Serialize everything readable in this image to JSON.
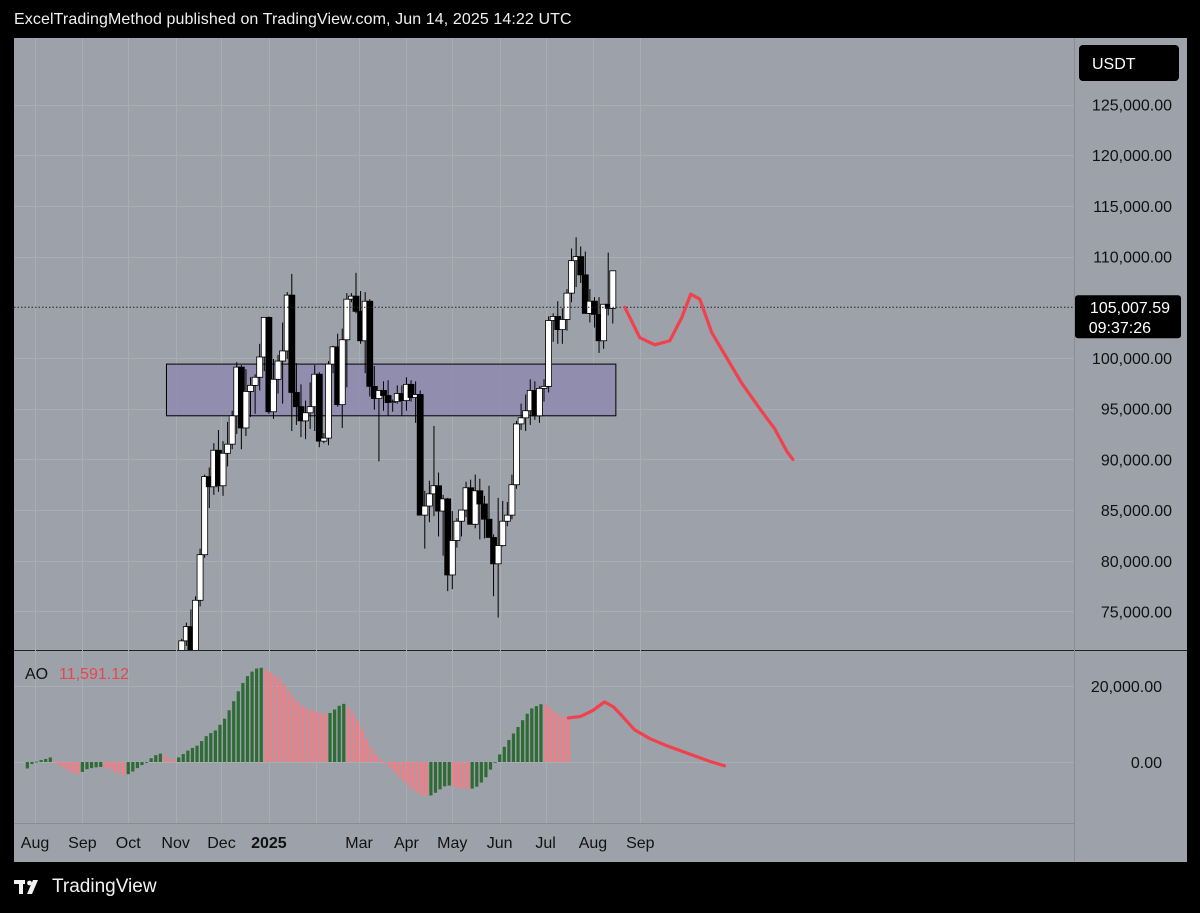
{
  "header": {
    "published": "ExcelTradingMethod published on TradingView.com, Jun 14, 2025 14:22 UTC"
  },
  "footer": {
    "brand": "TradingView"
  },
  "colors": {
    "panel_bg": "#9da1a9",
    "bull": "#ffffff",
    "bear": "#000000",
    "zone_fill": "#8e8aaf",
    "projection": "#f0414d",
    "ao_green": "#2e6b35",
    "ao_red": "#ef7f86",
    "last_price_bg": "#000000"
  },
  "chart_data": [
    {
      "type": "candlestick",
      "symbol_unit": "USDT",
      "title": "",
      "x_axis": {
        "ticks": [
          "Aug",
          "Sep",
          "Oct",
          "Nov",
          "Dec",
          "2025",
          "Mar",
          "Apr",
          "May",
          "Jun",
          "Jul",
          "Aug",
          "Sep"
        ]
      },
      "y_axis": {
        "ticks": [
          "125,000.00",
          "120,000.00",
          "115,000.00",
          "110,000.00",
          "100,000.00",
          "95,000.00",
          "90,000.00",
          "85,000.00",
          "80,000.00",
          "75,000.00"
        ],
        "ylim": [
          70000,
          128000
        ]
      },
      "last_price": {
        "value": "105,007.59",
        "countdown": "09:37:26",
        "numeric": 105008
      },
      "zone": {
        "low": 94300,
        "high": 99400,
        "from": "2024-10-26",
        "to": "2025-08-16"
      },
      "candles_start_date": "2024-11-05",
      "candles": [
        [
          69400,
          72300,
          67200,
          72100
        ],
        [
          72100,
          73900,
          71600,
          73500
        ],
        [
          73500,
          75200,
          69700,
          70600
        ],
        [
          70600,
          76500,
          70400,
          76100
        ],
        [
          76100,
          81200,
          75500,
          80600
        ],
        [
          80600,
          88500,
          80300,
          88300
        ],
        [
          88300,
          89200,
          85200,
          87300
        ],
        [
          87300,
          91600,
          86500,
          90900
        ],
        [
          90900,
          92900,
          86800,
          87400
        ],
        [
          87400,
          91800,
          86400,
          90600
        ],
        [
          90600,
          93700,
          89300,
          91500
        ],
        [
          91500,
          94800,
          91000,
          94300
        ],
        [
          94300,
          99600,
          92500,
          99100
        ],
        [
          99100,
          99300,
          91000,
          93100
        ],
        [
          93100,
          98900,
          92300,
          96700
        ],
        [
          96700,
          98100,
          94200,
          97300
        ],
        [
          97300,
          98400,
          94500,
          98100
        ],
        [
          98100,
          101400,
          96800,
          100100
        ],
        [
          100100,
          104000,
          98700,
          104000
        ],
        [
          104000,
          104100,
          94500,
          94700
        ],
        [
          94700,
          99900,
          94000,
          97900
        ],
        [
          97900,
          100300,
          96500,
          99700
        ],
        [
          99700,
          103500,
          95500,
          100700
        ],
        [
          100700,
          106500,
          99900,
          106200
        ],
        [
          106200,
          108300,
          92800,
          96600
        ],
        [
          96600,
          99500,
          93400,
          95200
        ],
        [
          95200,
          97400,
          92200,
          93800
        ],
        [
          93800,
          95800,
          92000,
          94600
        ],
        [
          94600,
          97600,
          93000,
          95200
        ],
        [
          95200,
          99300,
          92800,
          98400
        ],
        [
          98400,
          98600,
          91200,
          91800
        ],
        [
          91800,
          92600,
          91600,
          92100
        ],
        [
          92100,
          99700,
          91400,
          99400
        ],
        [
          99400,
          101200,
          98500,
          101100
        ],
        [
          101100,
          102400,
          95200,
          95400
        ],
        [
          95400,
          102900,
          93100,
          101800
        ],
        [
          101800,
          106400,
          97100,
          105800
        ],
        [
          105800,
          106400,
          105500,
          106100
        ],
        [
          106100,
          108400,
          104400,
          104600
        ],
        [
          104600,
          106600,
          101400,
          101700
        ],
        [
          101700,
          106500,
          98500,
          105600
        ],
        [
          105600,
          105800,
          96200,
          97200
        ],
        [
          97200,
          99200,
          94900,
          96000
        ],
        [
          96000,
          96600,
          89800,
          96800
        ],
        [
          96800,
          97700,
          94800,
          96300
        ],
        [
          96300,
          97800,
          94300,
          95600
        ],
        [
          95600,
          95900,
          94700,
          95700
        ],
        [
          95700,
          97300,
          95500,
          96500
        ],
        [
          96500,
          97300,
          94300,
          95800
        ],
        [
          95800,
          98100,
          94800,
          97400
        ],
        [
          97400,
          97800,
          95700,
          96100
        ],
        [
          96100,
          97700,
          93600,
          96400
        ],
        [
          96400,
          96800,
          84500,
          84500
        ],
        [
          84500,
          86900,
          81200,
          85400
        ],
        [
          85400,
          87900,
          83800,
          86600
        ],
        [
          86600,
          93300,
          84400,
          87400
        ],
        [
          87400,
          88700,
          82400,
          84900
        ],
        [
          84900,
          86500,
          80500,
          86100
        ],
        [
          86100,
          86200,
          77000,
          78600
        ],
        [
          78600,
          84900,
          77200,
          82000
        ],
        [
          82000,
          84200,
          81300,
          83900
        ],
        [
          83900,
          84700,
          82400,
          85000
        ],
        [
          85000,
          87800,
          84300,
          87200
        ],
        [
          87200,
          88000,
          83800,
          83600
        ],
        [
          83600,
          88500,
          83200,
          86900
        ],
        [
          86900,
          88100,
          82100,
          85600
        ],
        [
          85600,
          86400,
          82200,
          84100
        ],
        [
          84100,
          87400,
          82300,
          82300
        ],
        [
          82300,
          82600,
          76500,
          79700
        ],
        [
          79700,
          86200,
          74400,
          81500
        ],
        [
          81500,
          85900,
          81400,
          83900
        ],
        [
          83900,
          85800,
          83400,
          84500
        ],
        [
          84500,
          88500,
          84100,
          87500
        ],
        [
          87500,
          93800,
          87100,
          93500
        ],
        [
          93500,
          95500,
          92900,
          94100
        ],
        [
          94100,
          96400,
          92800,
          94800
        ],
        [
          94800,
          97900,
          93400,
          96800
        ],
        [
          96800,
          97700,
          93900,
          94300
        ],
        [
          94300,
          97200,
          93600,
          97000
        ],
        [
          97000,
          97900,
          95700,
          97200
        ],
        [
          97200,
          104100,
          96600,
          103700
        ],
        [
          103700,
          104400,
          101600,
          104100
        ],
        [
          104100,
          105600,
          101400,
          102800
        ],
        [
          102800,
          104900,
          101400,
          103800
        ],
        [
          103800,
          106800,
          102700,
          106400
        ],
        [
          106400,
          110800,
          105500,
          109600
        ],
        [
          109600,
          111900,
          107000,
          110000
        ],
        [
          110000,
          111000,
          107400,
          108200
        ],
        [
          108200,
          110500,
          106300,
          104400
        ],
        [
          104400,
          106800,
          103500,
          105600
        ],
        [
          105600,
          106000,
          103000,
          104300
        ],
        [
          104300,
          106000,
          100500,
          101700
        ],
        [
          101700,
          105200,
          100900,
          105300
        ],
        [
          105300,
          110400,
          104200,
          104900
        ],
        [
          104900,
          108600,
          103400,
          108600
        ]
      ],
      "projection": [
        [
          0,
          105000
        ],
        [
          5,
          102000
        ],
        [
          10,
          101300
        ],
        [
          15,
          101700
        ],
        [
          19,
          104000
        ],
        [
          22,
          106300
        ],
        [
          25,
          105800
        ],
        [
          29,
          102500
        ],
        [
          34,
          100000
        ],
        [
          39,
          97500
        ],
        [
          45,
          95000
        ],
        [
          50,
          93000
        ],
        [
          54,
          90800
        ],
        [
          56,
          90000
        ]
      ]
    },
    {
      "type": "bar",
      "name": "AO",
      "current_value_label": "11,591.12",
      "y_axis": {
        "ticks": [
          "20,000.00",
          "0.00"
        ],
        "ylim": [
          -9500,
          25500
        ]
      },
      "values": [
        -1700,
        -500,
        100,
        500,
        800,
        1200,
        500,
        -800,
        -1600,
        -2300,
        -2900,
        -3200,
        -2600,
        -1900,
        -1600,
        -1400,
        -1300,
        -1500,
        -1900,
        -2500,
        -3100,
        -3500,
        -3200,
        -2500,
        -1600,
        -800,
        0,
        1000,
        1800,
        2200,
        1700,
        800,
        700,
        1200,
        2100,
        3000,
        3700,
        4300,
        5500,
        6800,
        7600,
        8300,
        9800,
        11400,
        13600,
        16000,
        18600,
        20800,
        22600,
        23800,
        24600,
        24800,
        24200,
        23600,
        22800,
        21800,
        20300,
        18700,
        17000,
        15700,
        14700,
        14000,
        13600,
        13200,
        12800,
        12600,
        12900,
        13800,
        14800,
        15300,
        14400,
        12800,
        10800,
        8600,
        6100,
        3700,
        1900,
        700,
        -400,
        -1400,
        -2500,
        -3800,
        -5000,
        -6200,
        -7200,
        -8100,
        -8700,
        -8900,
        -8800,
        -8100,
        -7200,
        -6400,
        -6200,
        -6500,
        -6700,
        -6900,
        -7100,
        -7000,
        -6500,
        -5400,
        -4000,
        -2000,
        0,
        2000,
        4000,
        5800,
        7500,
        9200,
        11000,
        12700,
        14100,
        14700,
        15200,
        15000,
        14200,
        13200,
        12300,
        11800,
        11600
      ],
      "projection": [
        [
          0,
          11600
        ],
        [
          4,
          12000
        ],
        [
          8,
          13500
        ],
        [
          12,
          15800
        ],
        [
          15,
          14500
        ],
        [
          18,
          12000
        ],
        [
          22,
          8500
        ],
        [
          27,
          6200
        ],
        [
          33,
          4200
        ],
        [
          40,
          2200
        ],
        [
          47,
          200
        ],
        [
          52,
          -1000
        ]
      ]
    }
  ]
}
